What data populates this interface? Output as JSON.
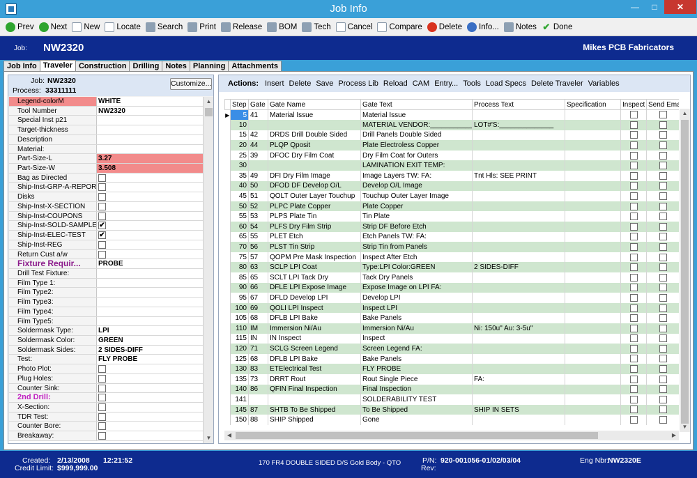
{
  "window": {
    "title": "Job Info"
  },
  "toolbar": [
    {
      "label": "Prev",
      "icon": "prev-icon"
    },
    {
      "label": "Next",
      "icon": "next-icon"
    },
    {
      "label": "New",
      "icon": "new-icon"
    },
    {
      "label": "Locate",
      "icon": "locate-icon"
    },
    {
      "label": "Search",
      "icon": "search-icon"
    },
    {
      "label": "Print",
      "icon": "print-icon"
    },
    {
      "label": "Release",
      "icon": "release-icon"
    },
    {
      "label": "BOM",
      "icon": "bom-icon"
    },
    {
      "label": "Tech",
      "icon": "tech-icon"
    },
    {
      "label": "Cancel",
      "icon": "cancel-icon"
    },
    {
      "label": "Compare",
      "icon": "compare-icon"
    },
    {
      "label": "Delete",
      "icon": "delete-icon"
    },
    {
      "label": "Info...",
      "icon": "info-icon"
    },
    {
      "label": "Notes",
      "icon": "notes-icon"
    },
    {
      "label": "Done",
      "icon": "done-icon"
    }
  ],
  "job": {
    "label": "Job:",
    "value": "NW2320",
    "company": "Mikes PCB Fabricators"
  },
  "tabs": [
    "Job Info",
    "Traveler",
    "Construction",
    "Drilling",
    "Notes",
    "Planning",
    "Attachments"
  ],
  "left": {
    "job_label": "Job:",
    "job_value": "NW2320",
    "process_label": "Process:",
    "process_value": "33311111",
    "customize": "Customize...",
    "props": [
      {
        "label": "Legend-colorM",
        "value": "WHITE",
        "style": "red-label"
      },
      {
        "label": "Tool Number",
        "value": "NW2320"
      },
      {
        "label": "Special Inst p21",
        "value": ""
      },
      {
        "label": "Target-thickness",
        "value": ""
      },
      {
        "label": "Description",
        "value": ""
      },
      {
        "label": "Material:",
        "value": ""
      },
      {
        "label": "Part-Size-L",
        "value": "3.27",
        "style": "red"
      },
      {
        "label": "Part-Size-W",
        "value": "3.508",
        "style": "red"
      },
      {
        "label": "Bag as Directed",
        "check": false
      },
      {
        "label": "Ship-Inst-GRP-A-REPORT",
        "check": false
      },
      {
        "label": "Disks",
        "check": false
      },
      {
        "label": "Ship-Inst-X-SECTION",
        "check": false
      },
      {
        "label": "Ship-Inst-COUPONS",
        "check": false
      },
      {
        "label": "Ship-Inst-SOLD-SAMPLE",
        "check": true
      },
      {
        "label": "Ship-Inst-ELEC-TEST",
        "check": true
      },
      {
        "label": "Ship-Inst-REG",
        "check": false
      },
      {
        "label": "Return Cust a/w",
        "check": false
      },
      {
        "label": "Fixture Requir...",
        "value": "PROBE",
        "style": "section"
      },
      {
        "label": "Drill Test Fixture:",
        "value": ""
      },
      {
        "label": "Film Type 1:",
        "value": ""
      },
      {
        "label": "Film Type2:",
        "value": ""
      },
      {
        "label": "Film Type3:",
        "value": ""
      },
      {
        "label": "Film Type4:",
        "value": ""
      },
      {
        "label": "Film Type5:",
        "value": ""
      },
      {
        "label": "Soldermask Type:",
        "value": "LPI"
      },
      {
        "label": "Soldermask Color:",
        "value": "GREEN"
      },
      {
        "label": "Soldermask Sides:",
        "value": "2 SIDES-DIFF"
      },
      {
        "label": "Test:",
        "value": "FLY PROBE"
      },
      {
        "label": "Photo Plot:",
        "check": false
      },
      {
        "label": "Plug Holes:",
        "check": false
      },
      {
        "label": "Counter Sink:",
        "check": false
      },
      {
        "label": "2nd Drill:",
        "check": false,
        "style": "section2"
      },
      {
        "label": "X-Section:",
        "check": false
      },
      {
        "label": "TDR Test:",
        "check": false
      },
      {
        "label": "Counter Bore:",
        "check": false
      },
      {
        "label": "Breakaway:",
        "check": false
      }
    ]
  },
  "actions": {
    "label": "Actions:",
    "items": [
      "Insert",
      "Delete",
      "Save",
      "Process Lib",
      "Reload",
      "CAM",
      "Entry...",
      "Tools",
      "Load Specs",
      "Delete Traveler",
      "Variables"
    ]
  },
  "grid": {
    "columns": [
      "Step",
      "Gate",
      "Gate Name",
      "Gate Text",
      "Process Text",
      "Specification",
      "Inspect",
      "Send Email"
    ],
    "rows": [
      [
        "5",
        "41",
        "Material Issue",
        "Material Issue",
        "",
        ""
      ],
      [
        "10",
        "",
        "",
        "MATERIAL VENDOR:___________",
        "LOT#'S:______________",
        ""
      ],
      [
        "15",
        "42",
        "DRDS Drill Double Sided",
        "Drill Panels Double Sided",
        "",
        ""
      ],
      [
        "20",
        "44",
        "PLQP Qposit",
        "Plate Electroless Copper",
        "",
        ""
      ],
      [
        "25",
        "39",
        "DFOC Dry Film Coat",
        "Dry Film Coat for Outers",
        "",
        ""
      ],
      [
        "30",
        "",
        "",
        "LAMINATION EXIT TEMP:",
        "",
        ""
      ],
      [
        "35",
        "49",
        "DFI Dry Film Image",
        "Image Layers TW:     FA:",
        "Tnt Hls: SEE PRINT",
        ""
      ],
      [
        "40",
        "50",
        "DFOD DF Develop O/L",
        "Develop O/L Image",
        "",
        ""
      ],
      [
        "45",
        "51",
        "QOLT Outer Layer Touchup",
        "Touchup Outer Layer Image",
        "",
        ""
      ],
      [
        "50",
        "52",
        "PLPC Plate Copper",
        "Plate Copper",
        "",
        ""
      ],
      [
        "55",
        "53",
        "PLPS Plate Tin",
        "Tin Plate",
        "",
        ""
      ],
      [
        "60",
        "54",
        "PLFS Dry Film Strip",
        "Strip DF Before Etch",
        "",
        ""
      ],
      [
        "65",
        "55",
        "PLET Etch",
        "Etch Panels TW:      FA:",
        "",
        ""
      ],
      [
        "70",
        "56",
        "PLST Tin Strip",
        "Strip Tin from Panels",
        "",
        ""
      ],
      [
        "75",
        "57",
        "QOPM Pre Mask Inspection",
        "Inspect After Etch",
        "",
        ""
      ],
      [
        "80",
        "63",
        "SCLP LPI Coat",
        "Type:LPI Color:GREEN",
        "2 SIDES-DIFF",
        ""
      ],
      [
        "85",
        "65",
        "SCLT LPI Tack Dry",
        "Tack Dry Panels",
        "",
        ""
      ],
      [
        "90",
        "66",
        "DFLE LPI Expose Image",
        "Expose Image on LPI      FA:",
        "",
        ""
      ],
      [
        "95",
        "67",
        "DFLD Develop LPI",
        "Develop LPI",
        "",
        ""
      ],
      [
        "100",
        "69",
        "QOLI LPI Inspect",
        "Inspect LPI",
        "",
        ""
      ],
      [
        "105",
        "68",
        "DFLB LPI Bake",
        "Bake Panels",
        "",
        ""
      ],
      [
        "110",
        "IM",
        "Immersion Ni/Au",
        "Immersion Ni/Au",
        "Ni: 150u\"   Au: 3-5u\"",
        ""
      ],
      [
        "115",
        "IN",
        "IN Inspect",
        "Inspect",
        "",
        ""
      ],
      [
        "120",
        "71",
        "SCLG Screen Legend",
        "Screen Legend            FA:",
        "",
        ""
      ],
      [
        "125",
        "68",
        "DFLB LPI Bake",
        "Bake Panels",
        "",
        ""
      ],
      [
        "130",
        "83",
        "ETElectrical Test",
        "FLY PROBE",
        "",
        ""
      ],
      [
        "135",
        "73",
        "DRRT Rout",
        "Rout Single Piece",
        "FA:",
        ""
      ],
      [
        "140",
        "86",
        "QFIN Final Inspection",
        "Final Inspection",
        "",
        ""
      ],
      [
        "141",
        "",
        "",
        "SOLDERABILITY TEST",
        "",
        ""
      ],
      [
        "145",
        "87",
        "SHTB To Be Shipped",
        "To Be Shipped",
        "SHIP IN SETS",
        ""
      ],
      [
        "150",
        "88",
        "SHIP Shipped",
        "Gone",
        "",
        ""
      ]
    ]
  },
  "status": {
    "created_label": "Created:",
    "created_date": "2/13/2008",
    "created_time": "12:21:52",
    "credit_label": "Credit Limit:",
    "credit_value": "$999,999.00",
    "description": "170 FR4 DOUBLE SIDED D/S Gold Body - QTO",
    "pn_label": "P/N:",
    "pn_value": "920-001056-01/02/03/04",
    "rev_label": "Rev:",
    "eng_label": "Eng Nbr:",
    "eng_value": "NW2320E"
  },
  "colors": {
    "title_blue": "#3aa0d8",
    "navy": "#0e2b8f",
    "row_green": "#cfe6cf",
    "prop_red": "#f28b8b"
  }
}
